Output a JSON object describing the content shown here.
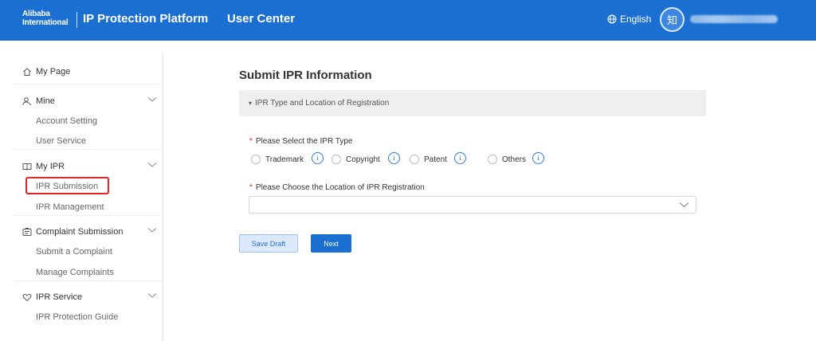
{
  "header": {
    "logo_line1": "Alibaba",
    "logo_line2": "International",
    "platform_title": "IP Protection Platform",
    "section": "User Center",
    "language": "English",
    "avatar_char": "知"
  },
  "sidebar": {
    "my_page": "My Page",
    "mine": {
      "label": "Mine",
      "items": [
        "Account Setting",
        "User Service"
      ]
    },
    "my_ipr": {
      "label": "My IPR",
      "items": [
        "IPR Submission",
        "IPR Management"
      ]
    },
    "complaint": {
      "label": "Complaint Submission",
      "items": [
        "Submit a Complaint",
        "Manage Complaints"
      ]
    },
    "ipr_service": {
      "label": "IPR Service",
      "items": [
        "IPR Protection Guide"
      ]
    }
  },
  "main": {
    "title": "Submit IPR Information",
    "section_label": "IPR Type and Location of Registration",
    "ipr_type_label": "Please Select the IPR Type",
    "ipr_types": [
      "Trademark",
      "Copyright",
      "Patent",
      "Others"
    ],
    "location_label": "Please Choose the Location of IPR Registration",
    "location_value": "",
    "required_mark": "*",
    "info_glyph": "i",
    "section_caret": "▾"
  },
  "buttons": {
    "save_draft": "Save Draft",
    "next": "Next"
  },
  "colors": {
    "brand_blue": "#1b6fd1",
    "highlight_red": "#e02525"
  }
}
